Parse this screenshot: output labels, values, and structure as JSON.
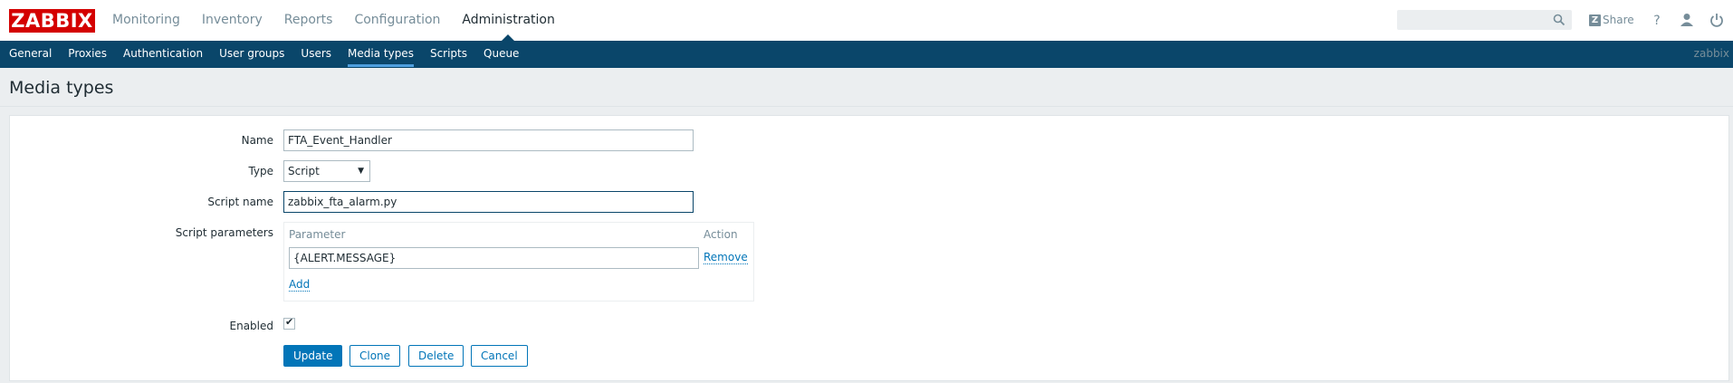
{
  "brand": {
    "logo_text": "ZABBIX",
    "color": "#d40000"
  },
  "main_nav": {
    "items": [
      "Monitoring",
      "Inventory",
      "Reports",
      "Configuration",
      "Administration"
    ],
    "active": "Administration"
  },
  "header_tools": {
    "search_placeholder": "",
    "search_value": "",
    "share_label": "Share",
    "icons": [
      "search-icon",
      "zabbix-share-icon",
      "help-icon",
      "user-profile-icon",
      "sign-out-icon"
    ]
  },
  "sub_nav": {
    "items": [
      "General",
      "Proxies",
      "Authentication",
      "User groups",
      "Users",
      "Media types",
      "Scripts",
      "Queue"
    ],
    "active": "Media types",
    "server_name": "zabbix"
  },
  "page": {
    "title": "Media types"
  },
  "form": {
    "name_label": "Name",
    "name_value": "FTA_Event_Handler",
    "type_label": "Type",
    "type_value": "Script",
    "script_name_label": "Script name",
    "script_name_value": "zabbix_fta_alarm.py",
    "script_params_label": "Script parameters",
    "params_header_parameter": "Parameter",
    "params_header_action": "Action",
    "param_value": "{ALERT.MESSAGE}",
    "remove_label": "Remove",
    "add_label": "Add",
    "enabled_label": "Enabled",
    "enabled_checked": true
  },
  "buttons": {
    "update": "Update",
    "clone": "Clone",
    "delete": "Delete",
    "cancel": "Cancel"
  },
  "colors": {
    "accent": "#0275b8",
    "subnav_bg": "#0a466a",
    "page_bg": "#ebeef0"
  }
}
